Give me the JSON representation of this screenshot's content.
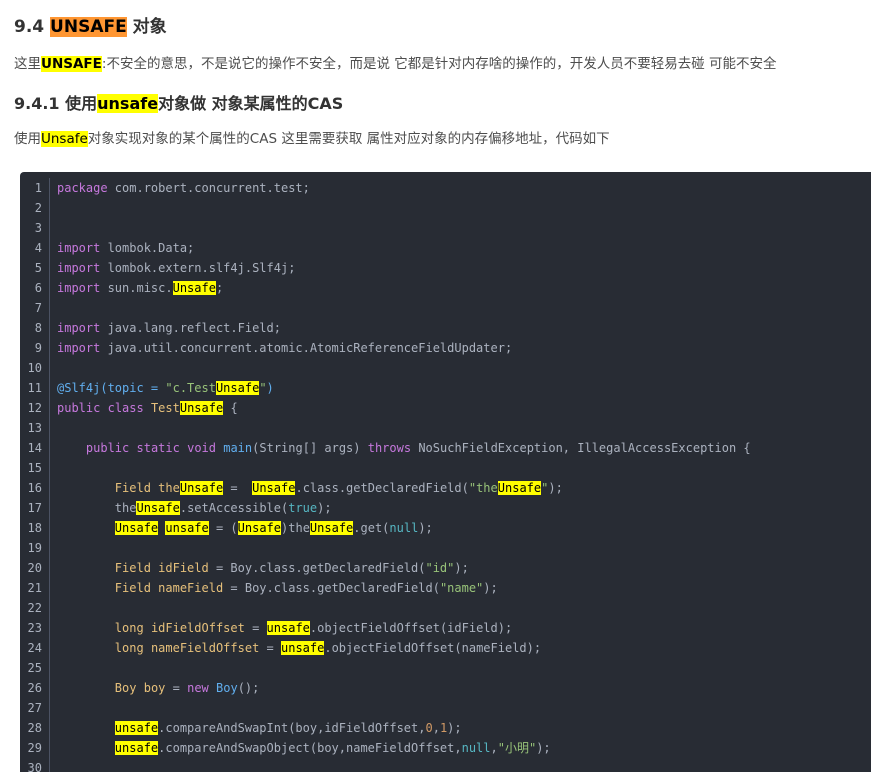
{
  "heading1": {
    "number": "9.4 ",
    "highlight": "UNSAFE",
    "rest": " 对象"
  },
  "para1": {
    "pre": "这里",
    "highlight": "UNSAFE",
    "rest": ":不安全的意思，不是说它的操作不安全，而是说 它都是针对内存啥的操作的，开发人员不要轻易去碰 可能不安全"
  },
  "heading2": {
    "pre": "9.4.1 使用",
    "highlight": "unsafe",
    "rest": "对象做 对象某属性的CAS"
  },
  "para2": {
    "pre": "使用",
    "highlight": "Unsafe",
    "rest": "对象实现对象的某个属性的CAS 这里需要获取 属性对应对象的内存偏移地址，代码如下"
  },
  "code": {
    "line_numbers": [
      "1",
      "2",
      "3",
      "4",
      "5",
      "6",
      "7",
      "8",
      "9",
      "10",
      "11",
      "12",
      "13",
      "14",
      "15",
      "16",
      "17",
      "18",
      "19",
      "20",
      "21",
      "22",
      "23",
      "24",
      "25",
      "26",
      "27",
      "28",
      "29",
      "30"
    ],
    "l1": [
      "package",
      " com.robert.concurrent.test;"
    ],
    "l4": [
      "import",
      " lombok.Data;"
    ],
    "l5": [
      "import",
      " lombok.extern.slf4j.Slf4j;"
    ],
    "l6": [
      "import",
      " sun.misc.",
      "Unsafe",
      ";"
    ],
    "l8": [
      "import",
      " java.lang.reflect.Field;"
    ],
    "l9": [
      "import",
      " java.util.concurrent.atomic.AtomicReferenceFieldUpdater;"
    ],
    "l11": [
      "@Slf4j(topic = ",
      "\"c.Test",
      "Unsafe",
      "\"",
      ")"
    ],
    "l12": [
      "public",
      " ",
      "class",
      " ",
      "Test",
      "Unsafe",
      " {"
    ],
    "l14": [
      "    ",
      "public",
      " ",
      "static",
      " ",
      "void",
      " ",
      "main",
      "(String[] args) ",
      "throws",
      " NoSuchFieldException, IllegalAccessException {"
    ],
    "l16": [
      "        ",
      "Field",
      " ",
      "the",
      "Unsafe",
      " =  ",
      "Unsafe",
      ".class.getDeclaredField(",
      "\"the",
      "Unsafe",
      "\"",
      ");"
    ],
    "l17": [
      "        ",
      "the",
      "Unsafe",
      ".setAccessible(",
      "true",
      ");"
    ],
    "l18": [
      "        ",
      "Unsafe",
      " ",
      "unsafe",
      " = (",
      "Unsafe",
      ")the",
      "Unsafe",
      ".get(",
      "null",
      ");"
    ],
    "l20": [
      "        ",
      "Field",
      " ",
      "idField",
      " = Boy.class.getDeclaredField(",
      "\"id\"",
      ");"
    ],
    "l21": [
      "        ",
      "Field",
      " ",
      "nameField",
      " = Boy.class.getDeclaredField(",
      "\"name\"",
      ");"
    ],
    "l23": [
      "        ",
      "long",
      " ",
      "idFieldOffset",
      " = ",
      "unsafe",
      ".objectFieldOffset(idField);"
    ],
    "l24": [
      "        ",
      "long",
      " ",
      "nameFieldOffset",
      " = ",
      "unsafe",
      ".objectFieldOffset(nameField);"
    ],
    "l26": [
      "        ",
      "Boy",
      " ",
      "boy",
      " = ",
      "new",
      " ",
      "Boy",
      "();"
    ],
    "l28": [
      "        ",
      "unsafe",
      ".compareAndSwapInt(boy,idFieldOffset,",
      "0",
      ",",
      "1",
      ");"
    ],
    "l29": [
      "        ",
      "unsafe",
      ".compareAndSwapObject(boy,nameFieldOffset,",
      "null",
      ",",
      "\"小明\"",
      ");"
    ]
  },
  "colors": {
    "code_bg": "#282c34",
    "keyword": "#c678dd",
    "type": "#e6c07b",
    "function": "#61aeee",
    "string": "#98c379",
    "number": "#d19a66",
    "highlight": "#ffff00",
    "title_highlight": "#ff9632"
  }
}
